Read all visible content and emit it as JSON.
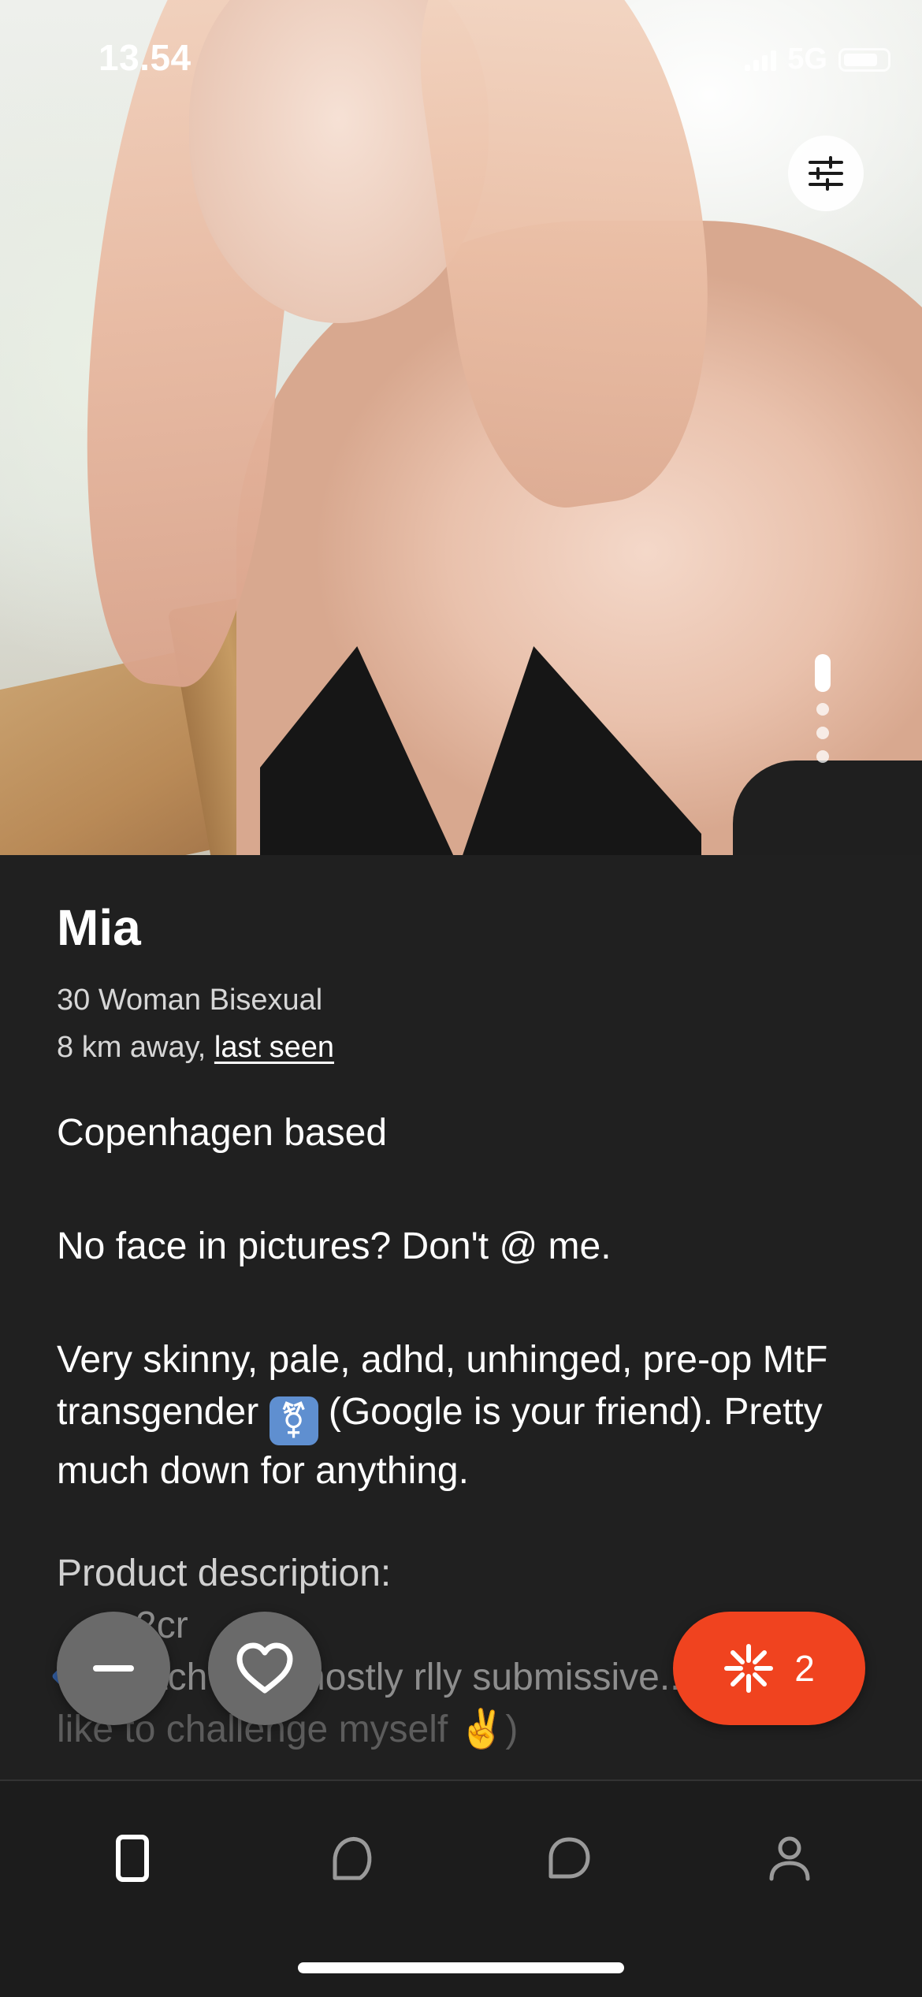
{
  "status_bar": {
    "time": "13.54",
    "network": "5G"
  },
  "profile": {
    "name": "Mia",
    "details": "30 Woman Bisexual",
    "distance": "8 km away,",
    "last_seen": "last seen",
    "bio_line1": "Copenhagen based",
    "bio_line2": "No face in pictures? Don't @ me.",
    "bio_line3a": "Very skinny, pale, adhd, unhinged, pre-op MtF transgender",
    "bio_emoji": "⚧",
    "bio_line3b": "(Google is your friend). Pretty much down for anything.",
    "desc_title": "Product description:",
    "desc_line1": "2cr",
    "desc_line2": "Switch (tbh mostly rlly submissive.. But I",
    "desc_line3": "like to challenge myself ✌️)"
  },
  "photo": {
    "total": 4,
    "current": 1
  },
  "actions": {
    "pass_icon": "minus-icon",
    "like_icon": "heart-icon",
    "ping_icon": "sparkle-icon",
    "ping_count": "2"
  },
  "nav": {
    "items": [
      {
        "name": "discover",
        "icon": "card-icon",
        "active": true
      },
      {
        "name": "likes",
        "icon": "blob-icon",
        "active": false
      },
      {
        "name": "chats",
        "icon": "chat-bubble-icon",
        "active": false
      },
      {
        "name": "profile",
        "icon": "person-icon",
        "active": false
      }
    ]
  },
  "colors": {
    "accent": "#f0431f",
    "background": "#202020",
    "nav_bg": "#1c1c1c"
  }
}
